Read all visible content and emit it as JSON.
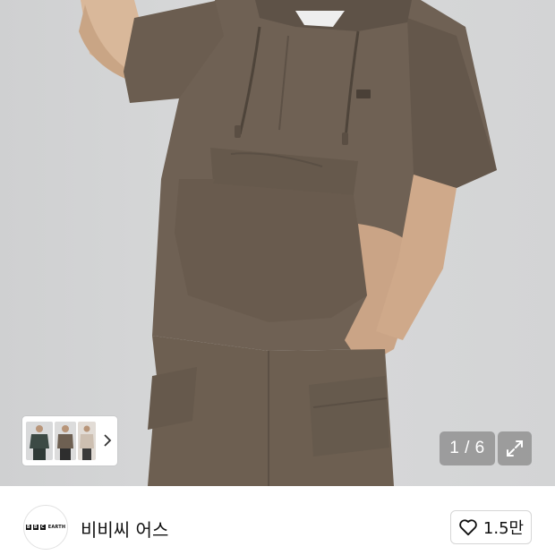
{
  "gallery": {
    "image_description_icon": "product-photo",
    "counter_text": "1 / 6",
    "expand_icon": "expand-icon",
    "thumbnails": [
      {
        "icon": "thumbnail-image"
      },
      {
        "icon": "thumbnail-image"
      },
      {
        "icon": "thumbnail-image"
      }
    ],
    "next_icon": "chevron-right-icon"
  },
  "brand": {
    "logo_bbc": [
      "B",
      "B",
      "C"
    ],
    "logo_earth": "EARTH",
    "name": "비비씨 어스"
  },
  "like": {
    "icon": "heart-icon",
    "count": "1.5만"
  },
  "colors": {
    "background": "#d6d7d8",
    "garment": "#6e6052",
    "overlay": "#6e6e6e"
  }
}
